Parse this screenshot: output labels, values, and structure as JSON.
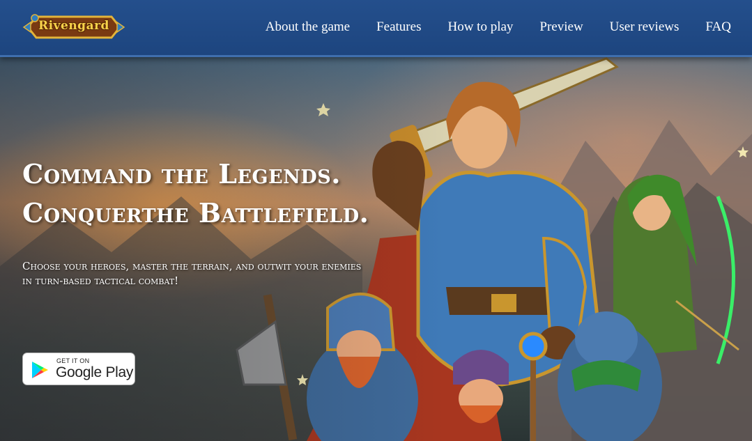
{
  "header": {
    "logo_text": "Rivengard",
    "nav": [
      {
        "label": "About the game"
      },
      {
        "label": "Features"
      },
      {
        "label": "How to play"
      },
      {
        "label": "Preview"
      },
      {
        "label": "User reviews"
      },
      {
        "label": "FAQ"
      }
    ]
  },
  "hero": {
    "headline_line1": "Command the Legends.",
    "headline_line2": "Conquerthe Battlefield.",
    "subline_line1": "Choose your heroes, master the terrain, and outwit your enemies",
    "subline_line2": "in turn-based tactical combat!",
    "store_button": {
      "small_text": "GET IT ON",
      "big_text": "Google Play"
    }
  },
  "colors": {
    "header_bg": "#1f4a86",
    "accent_gold": "#f7d24a",
    "text": "#ffffff"
  }
}
